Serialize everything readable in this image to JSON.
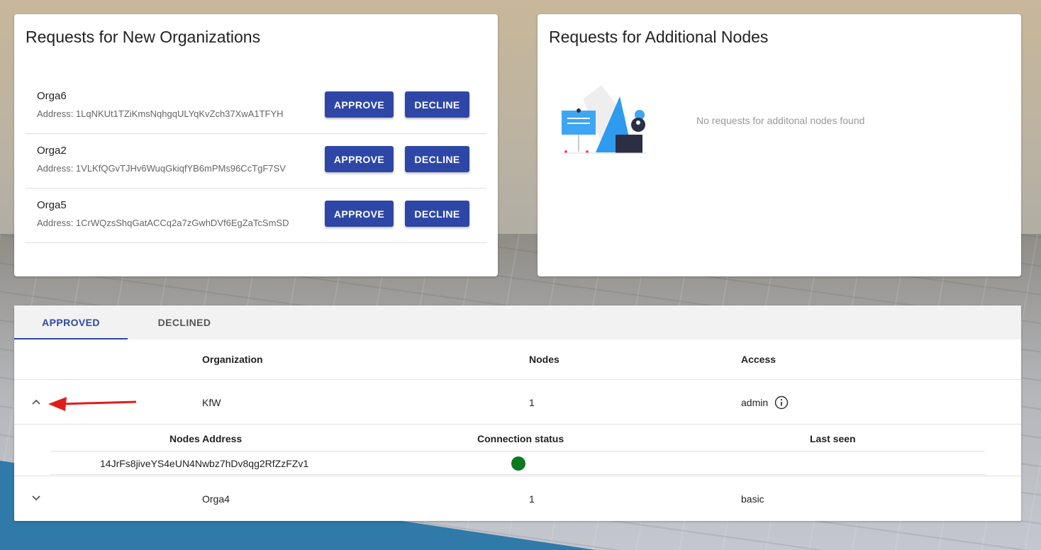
{
  "new_orgs": {
    "title": "Requests for New Organizations",
    "approve_label": "APPROVE",
    "decline_label": "DECLINE",
    "items": [
      {
        "name": "Orga6",
        "address": "Address: 1LqNKUt1TZiKmsNqhgqULYqKvZch37XwA1TFYH"
      },
      {
        "name": "Orga2",
        "address": "Address: 1VLKfQGvTJHv6WuqGkiqfYB6mPMs96CcTgF7SV"
      },
      {
        "name": "Orga5",
        "address": "Address: 1CrWQzsShqGatACCq2a7zGwhDVf6EgZaTcSmSD"
      }
    ]
  },
  "additional_nodes": {
    "title": "Requests for Additional Nodes",
    "empty_message": "No requests for additonal nodes found"
  },
  "tabs": {
    "approved": "APPROVED",
    "declined": "DECLINED"
  },
  "table": {
    "headers": {
      "organization": "Organization",
      "nodes": "Nodes",
      "access": "Access"
    },
    "rows": [
      {
        "organization": "KfW",
        "nodes": "1",
        "access": "admin",
        "expanded": true
      },
      {
        "organization": "Orga4",
        "nodes": "1",
        "access": "basic",
        "expanded": false
      }
    ],
    "sub_headers": {
      "address": "Nodes Address",
      "status": "Connection status",
      "last_seen": "Last seen"
    },
    "sub_rows": [
      {
        "address": "14JrFs8jiveYS4eUN4Nwbz7hDv8qg2RfZzFZv1",
        "status": "connected",
        "last_seen": ""
      }
    ]
  },
  "colors": {
    "primary": "#2e47a7",
    "status_connected": "#0a7a1e",
    "annotation_arrow": "#e11b1b"
  },
  "icons": {
    "expand": "chevron-up-icon",
    "collapse": "chevron-down-icon",
    "info": "info-icon"
  }
}
